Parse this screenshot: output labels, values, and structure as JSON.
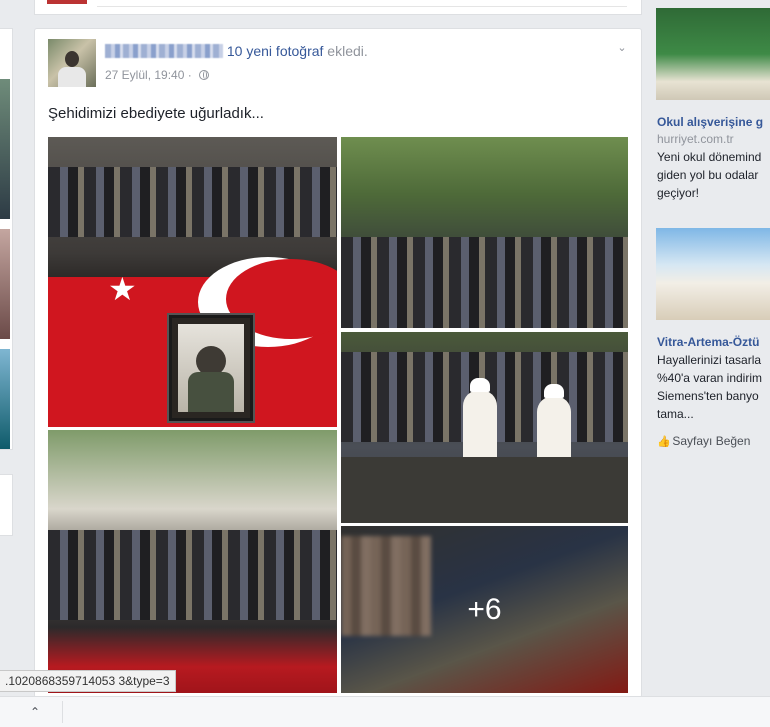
{
  "post": {
    "action": "10 yeni fotoğraf",
    "action_suffix": " ekledi.",
    "timestamp": "27 Eylül, 19:40",
    "separator": " · ",
    "message": "Şehidimizi ebediyete uğurladık...",
    "more_photos_overlay": "+6"
  },
  "ads": [
    {
      "title": "Okul alışverişine g",
      "domain": "hurriyet.com.tr",
      "lines": [
        "Yeni okul dönemind",
        "giden yol bu odalar",
        "geçiyor!"
      ]
    },
    {
      "title": "Vitra-Artema-Öztü",
      "lines": [
        "Hayallerinizi tasarla",
        "%40'a varan indirim",
        "Siemens'ten banyo",
        "tama..."
      ],
      "like_label": "Sayfayı Beğen"
    }
  ],
  "status_bar": {
    "url": ".1020868359714053 3&type=3"
  },
  "icons": {
    "chevron": "chevron-down-icon",
    "globe": "globe-icon",
    "like": "thumbs-up-icon",
    "up": "chevron-up-icon"
  },
  "colors": {
    "link": "#365899",
    "meta": "#90949c",
    "page_bg": "#e9ebee",
    "flag_red": "#d0161f"
  }
}
